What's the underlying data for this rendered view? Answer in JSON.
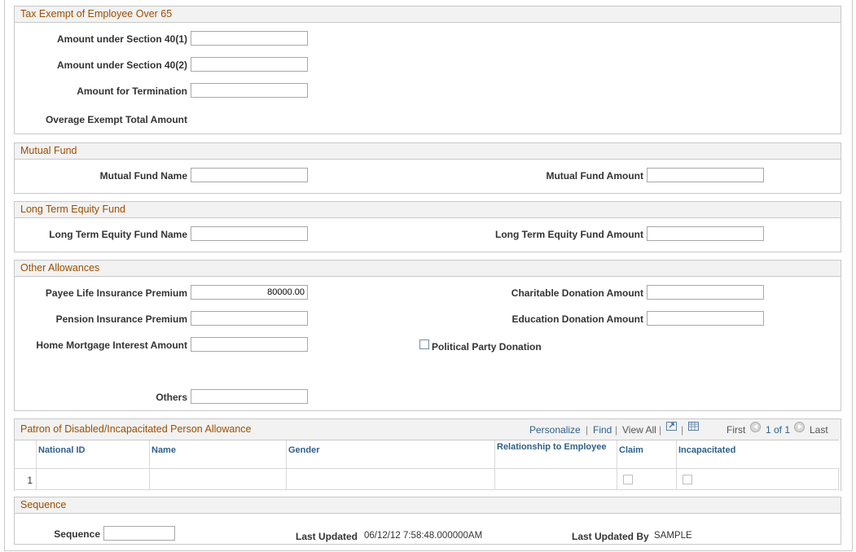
{
  "over65": {
    "title": "Tax Exempt of Employee Over 65",
    "sec40_1_label": "Amount under Section 40(1)",
    "sec40_1_value": "",
    "sec40_2_label": "Amount under Section 40(2)",
    "sec40_2_value": "",
    "termination_label": "Amount for Termination",
    "termination_value": "",
    "total_label": "Overage Exempt Total Amount"
  },
  "mutual_fund": {
    "title": "Mutual Fund",
    "name_label": "Mutual Fund Name",
    "name_value": "",
    "amount_label": "Mutual Fund Amount",
    "amount_value": ""
  },
  "ltef": {
    "title": "Long Term Equity Fund",
    "name_label": "Long Term Equity Fund Name",
    "name_value": "",
    "amount_label": "Long Term Equity Fund Amount",
    "amount_value": ""
  },
  "other": {
    "title": "Other Allowances",
    "life_label": "Payee Life Insurance Premium",
    "life_value": "80000.00",
    "pension_label": "Pension Insurance Premium",
    "pension_value": "",
    "mortgage_label": "Home Mortgage Interest Amount",
    "mortgage_value": "",
    "others_label": "Others",
    "others_value": "",
    "charitable_label": "Charitable Donation Amount",
    "charitable_value": "",
    "education_label": "Education Donation Amount",
    "education_value": "",
    "political_label": "Political Party Donation",
    "political_checked": false
  },
  "patron": {
    "title": "Patron of Disabled/Incapacitated Person Allowance",
    "personalize": "Personalize",
    "find": "Find",
    "view_all": "View All",
    "first": "First",
    "range": "1 of 1",
    "last": "Last",
    "columns": [
      "National ID",
      "Name",
      "Gender",
      "Relationship to Employee",
      "Claim",
      "Incapacitated"
    ],
    "rows": [
      {
        "num": "1",
        "national_id": "",
        "name": "",
        "gender": "",
        "relationship": "",
        "claim": false,
        "incapacitated": false
      }
    ]
  },
  "sequence": {
    "title": "Sequence",
    "seq_label": "Sequence",
    "seq_value": "",
    "updated_label": "Last Updated",
    "updated_value": "06/12/12  7:58:48.000000AM",
    "updated_by_label": "Last Updated By",
    "updated_by_value": "SAMPLE"
  },
  "colors": {
    "section_title": "#9c4e00",
    "link": "#2d5f8b",
    "border": "#c8c8c8"
  }
}
